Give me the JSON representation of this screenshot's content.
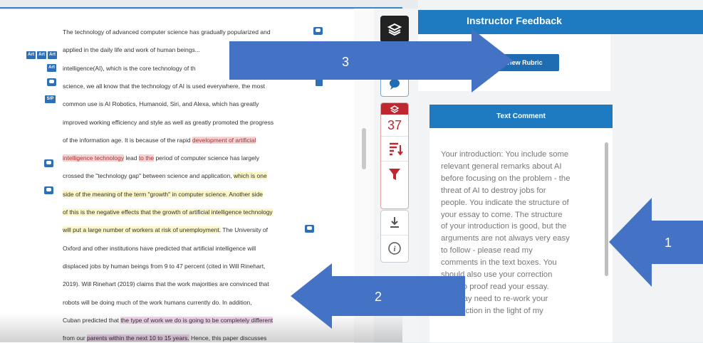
{
  "document": {
    "lines": [
      {
        "segments": [
          {
            "t": "The technology of advanced computer science has gradually popularized and"
          }
        ]
      },
      {
        "segments": [
          {
            "t": "applied in the daily life and work of human beings..."
          }
        ]
      },
      {
        "segments": [
          {
            "t": "intelligence(AI), which is the core technology of th"
          }
        ]
      },
      {
        "segments": [
          {
            "t": "science, we all know that the technology of AI is used everywhere, the most"
          }
        ]
      },
      {
        "segments": [
          {
            "t": "common use is AI Robotics, Humanoid, Siri, and Alexa, which has greatly"
          }
        ]
      },
      {
        "segments": [
          {
            "t": "improved working efficiency and style as well as greatly promoted the progress"
          }
        ]
      },
      {
        "segments": [
          {
            "t": "of the information age. It is because of the rapid "
          },
          {
            "t": "development of artificial",
            "h": "red"
          }
        ]
      },
      {
        "segments": [
          {
            "t": "intelligence technology",
            "h": "red"
          },
          {
            "t": " lead "
          },
          {
            "t": "to the",
            "h": "red"
          },
          {
            "t": " period of computer science has largely"
          }
        ]
      },
      {
        "segments": [
          {
            "t": "crossed the  \"technology gap\"  between science and application, "
          },
          {
            "t": "which is one",
            "h": "yel"
          }
        ]
      },
      {
        "segments": [
          {
            "t": "side of the meaning of the term  \"growth\"  in computer science. Another side",
            "h": "yel"
          }
        ]
      },
      {
        "segments": [
          {
            "t": "of this is the negative effects that the growth of artificial intelligence technology",
            "h": "yel"
          }
        ]
      },
      {
        "segments": [
          {
            "t": "will put a large number of workers at risk of unemployment.",
            "h": "yel"
          },
          {
            "t": " The University of"
          }
        ]
      },
      {
        "segments": [
          {
            "t": "Oxford and other institutions have predicted that artificial intelligence will"
          }
        ]
      },
      {
        "segments": [
          {
            "t": "displaced jobs by human beings from 9 to 47 percent (cited in Will Rinehart,"
          }
        ]
      },
      {
        "segments": [
          {
            "t": "2019). Will Rinehart (2019) claims that the work majorities are convinced that"
          }
        ]
      },
      {
        "segments": [
          {
            "t": "robots will be doing much of the work humans currently do. In addition,"
          }
        ]
      },
      {
        "segments": [
          {
            "t": "Cuban predicted that "
          },
          {
            "t": "the type of work we do is going to be completely different",
            "h": "pink"
          }
        ]
      },
      {
        "segments": [
          {
            "t": "from our "
          },
          {
            "t": "parents within the next 10 to 15 years.",
            "h": "pink"
          },
          {
            "t": " Hence, this paper discusses"
          }
        ]
      }
    ],
    "tags": [
      "Art",
      "Art",
      "Art",
      "Art",
      "S/P"
    ]
  },
  "toolbar": {
    "layers_icon": "layers-icon",
    "comment_icon": "comment-bubble-icon",
    "score": "37",
    "filter_icon": "filter-icon",
    "download_icon": "download-icon",
    "info_icon": "info-icon"
  },
  "feedback": {
    "header": "Instructor Feedback",
    "rubric_button": "View Rubric",
    "text_comment_header": "Text Comment",
    "text_comment": "Your introduction: You include some\nrelevant general remarks about AI\nbefore focusing on the problem - the\nthreat of AI to destroy jobs for\npeople. You indicate the structure of\nyour essay to come. The structure\nof your introduction is good, but the\narguments are not always very easy\nto follow - please read my\ncomments in the text boxes. You\nshould also use your correction\ncode to proof read your essay.\nYou may need to re-work your\nintroduction in the light of my"
  },
  "annotations": {
    "arrow1": "1",
    "arrow2": "2",
    "arrow3": "3"
  },
  "colors": {
    "accent": "#1e7bc2",
    "arrow": "#4472c4",
    "highlight_red": "#f6d3d3",
    "highlight_yellow": "#fbf6c8",
    "highlight_pink": "#f0d6ee"
  }
}
